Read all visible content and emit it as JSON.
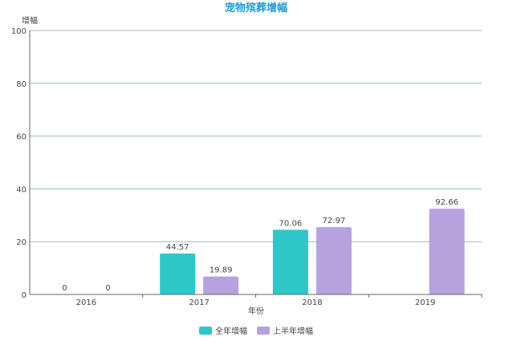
{
  "chart_data": {
    "type": "bar",
    "title": "宠物殡葬增幅",
    "ylabel": "增幅",
    "xlabel": "年份",
    "categories": [
      "2016",
      "2017",
      "2018",
      "2019"
    ],
    "ylim": [
      0,
      100
    ],
    "yticks": [
      0,
      20,
      40,
      60,
      80,
      100
    ],
    "grid": true,
    "legend_position": "bottom-center",
    "series": [
      {
        "name": "全年增幅",
        "color": "#2ec7c9",
        "bar_values": [
          0,
          15.5,
          24.5,
          null
        ],
        "labels": [
          "0",
          "44.57",
          "70.06",
          ""
        ]
      },
      {
        "name": "上半年增幅",
        "color": "#b6a2de",
        "bar_values": [
          0,
          6.8,
          25.5,
          32.5
        ],
        "labels": [
          "0",
          "19.89",
          "72.97",
          "92.66"
        ]
      }
    ],
    "colors": {
      "title": "#1c9bd9",
      "grid": "#9fb8b8",
      "axis": "#666666",
      "text": "#444444"
    }
  }
}
